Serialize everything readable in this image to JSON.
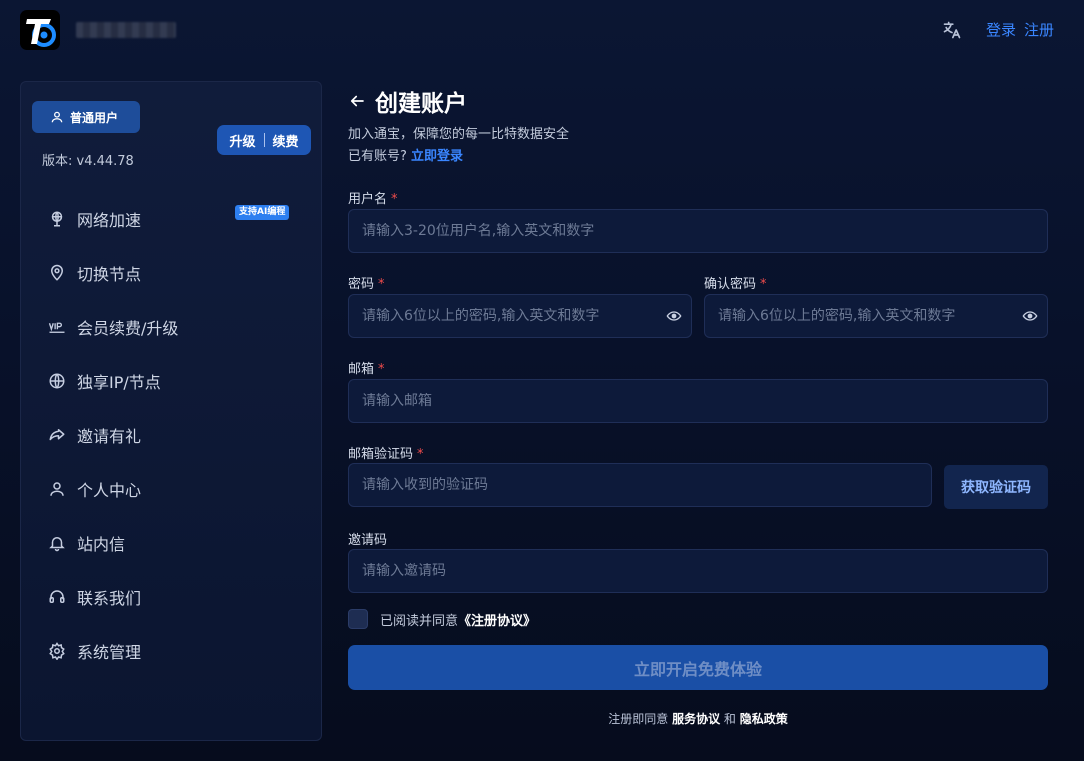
{
  "header": {
    "logo_icon": "app-logo-icon",
    "translate_icon": "translate-icon",
    "login_label": "登录",
    "register_label": "注册"
  },
  "sidebar": {
    "user_type": "普通用户",
    "upgrade": "升级",
    "renew": "续费",
    "version": "版本: v4.44.78",
    "items": [
      {
        "label": "网络加速",
        "icon": "globe-pin-icon",
        "badge": "支持AI编程"
      },
      {
        "label": "切换节点",
        "icon": "location-pin-icon"
      },
      {
        "label": "会员续费/升级",
        "icon": "vip-icon"
      },
      {
        "label": "独享IP/节点",
        "icon": "globe-icon"
      },
      {
        "label": "邀请有礼",
        "icon": "share-icon"
      },
      {
        "label": "个人中心",
        "icon": "user-icon"
      },
      {
        "label": "站内信",
        "icon": "bell-icon"
      },
      {
        "label": "联系我们",
        "icon": "headset-icon"
      },
      {
        "label": "系统管理",
        "icon": "gear-icon"
      }
    ]
  },
  "form": {
    "title": "创建账户",
    "subtitle": "加入通宝，保障您的每一比特数据安全",
    "have_account": "已有账号?",
    "login_now": "立即登录",
    "username": {
      "label": "用户名",
      "placeholder": "请输入3-20位用户名,输入英文和数字",
      "value": ""
    },
    "password": {
      "label": "密码",
      "placeholder": "请输入6位以上的密码,输入英文和数字",
      "value": ""
    },
    "confirm_password": {
      "label": "确认密码",
      "placeholder": "请输入6位以上的密码,输入英文和数字",
      "value": ""
    },
    "email": {
      "label": "邮箱",
      "placeholder": "请输入邮箱",
      "value": ""
    },
    "email_code": {
      "label": "邮箱验证码",
      "placeholder": "请输入收到的验证码",
      "value": ""
    },
    "get_code": "获取验证码",
    "invite_code": {
      "label": "邀请码",
      "placeholder": "请输入邀请码",
      "value": ""
    },
    "required_mark": "*",
    "agree_prefix": "已阅读并同意",
    "agree_link": "《注册协议》",
    "submit": "立即开启免费体验",
    "footer_prefix": "注册即同意",
    "service_agreement": "服务协议",
    "and": "和",
    "privacy_policy": "隐私政策"
  },
  "colors": {
    "accent": "#3a86ff",
    "button": "#1a4fa6",
    "required": "#f04c4c"
  }
}
